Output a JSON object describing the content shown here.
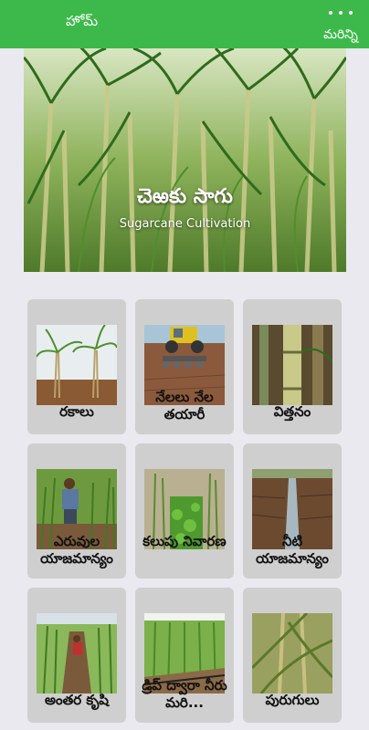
{
  "topbar": {
    "home_label": "హోమ్",
    "more_label": "మరిన్ని",
    "color": "#3cb94a"
  },
  "hero": {
    "title": "చెఱకు సాగు",
    "subtitle": "Sugarcane Cultivation"
  },
  "categories": [
    {
      "label": "రకాలు",
      "image": "sugarcane-plants"
    },
    {
      "label": "నేలలు నేల తయారీ",
      "image": "tractor-tilling"
    },
    {
      "label": "విత్తనం",
      "image": "cane-stalks"
    },
    {
      "label": "ఎరువుల యాజమాన్యం",
      "image": "farmer-fertilizing"
    },
    {
      "label": "కలుపు నివారణ",
      "image": "weed-field"
    },
    {
      "label": "నీటి యాజమాన్యం",
      "image": "irrigation-furrow"
    },
    {
      "label": "అంతర కృషి",
      "image": "intercultivation"
    },
    {
      "label": "డ్రిప్ ద్వారా నీరు మరి...",
      "image": "drip-irrigation"
    },
    {
      "label": "పురుగులు",
      "image": "pest-damage"
    }
  ]
}
